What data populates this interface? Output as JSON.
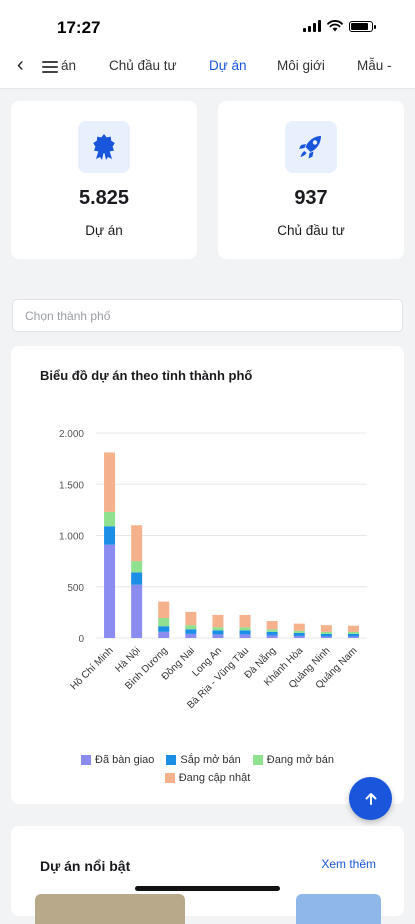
{
  "status_bar": {
    "time": "17:27"
  },
  "nav": {
    "tabs": [
      {
        "label": "án",
        "active": false
      },
      {
        "label": "Chủ đầu tư",
        "active": false
      },
      {
        "label": "Dự án",
        "active": true
      },
      {
        "label": "Môi giới",
        "active": false
      },
      {
        "label": "Mẫu -",
        "active": false
      }
    ]
  },
  "stats": [
    {
      "value": "5.825",
      "label": "Dự án",
      "icon": "award-icon"
    },
    {
      "value": "937",
      "label": "Chủ đầu tư",
      "icon": "rocket-icon"
    }
  ],
  "city_select": {
    "placeholder": "Chọn thành phố"
  },
  "chart_card": {
    "title": "Biểu đồ dự án theo tỉnh thành phố"
  },
  "chart_data": {
    "type": "bar",
    "stacked": true,
    "categories": [
      "Hồ Chí Minh",
      "Hà Nội",
      "Bình Dương",
      "Đồng Nai",
      "Long An",
      "Bà Rịa - Vũng Tàu",
      "Đà Nẵng",
      "Khánh Hòa",
      "Quảng Ninh",
      "Quảng Nam"
    ],
    "series": [
      {
        "name": "Đã bàn giao",
        "color": "#8b8cf0",
        "values": [
          910,
          520,
          60,
          40,
          35,
          35,
          25,
          20,
          15,
          15
        ]
      },
      {
        "name": "Sắp mở bán",
        "color": "#1b8fe6",
        "values": [
          180,
          120,
          55,
          45,
          40,
          40,
          35,
          30,
          25,
          25
        ]
      },
      {
        "name": "Đang mở bán",
        "color": "#8fe08f",
        "values": [
          140,
          110,
          80,
          40,
          30,
          30,
          25,
          20,
          20,
          20
        ]
      },
      {
        "name": "Đang cập nhật",
        "color": "#f5b08c",
        "values": [
          580,
          350,
          160,
          130,
          120,
          120,
          80,
          70,
          65,
          60
        ]
      }
    ],
    "y_ticks": [
      "0",
      "500",
      "1.000",
      "1.500",
      "2.000"
    ],
    "ylim": [
      0,
      2000
    ],
    "grid": true,
    "legend_position": "bottom"
  },
  "featured": {
    "title": "Dự án nổi bật",
    "see_more": "Xem thêm"
  },
  "fab": {
    "icon": "arrow-up-icon"
  }
}
